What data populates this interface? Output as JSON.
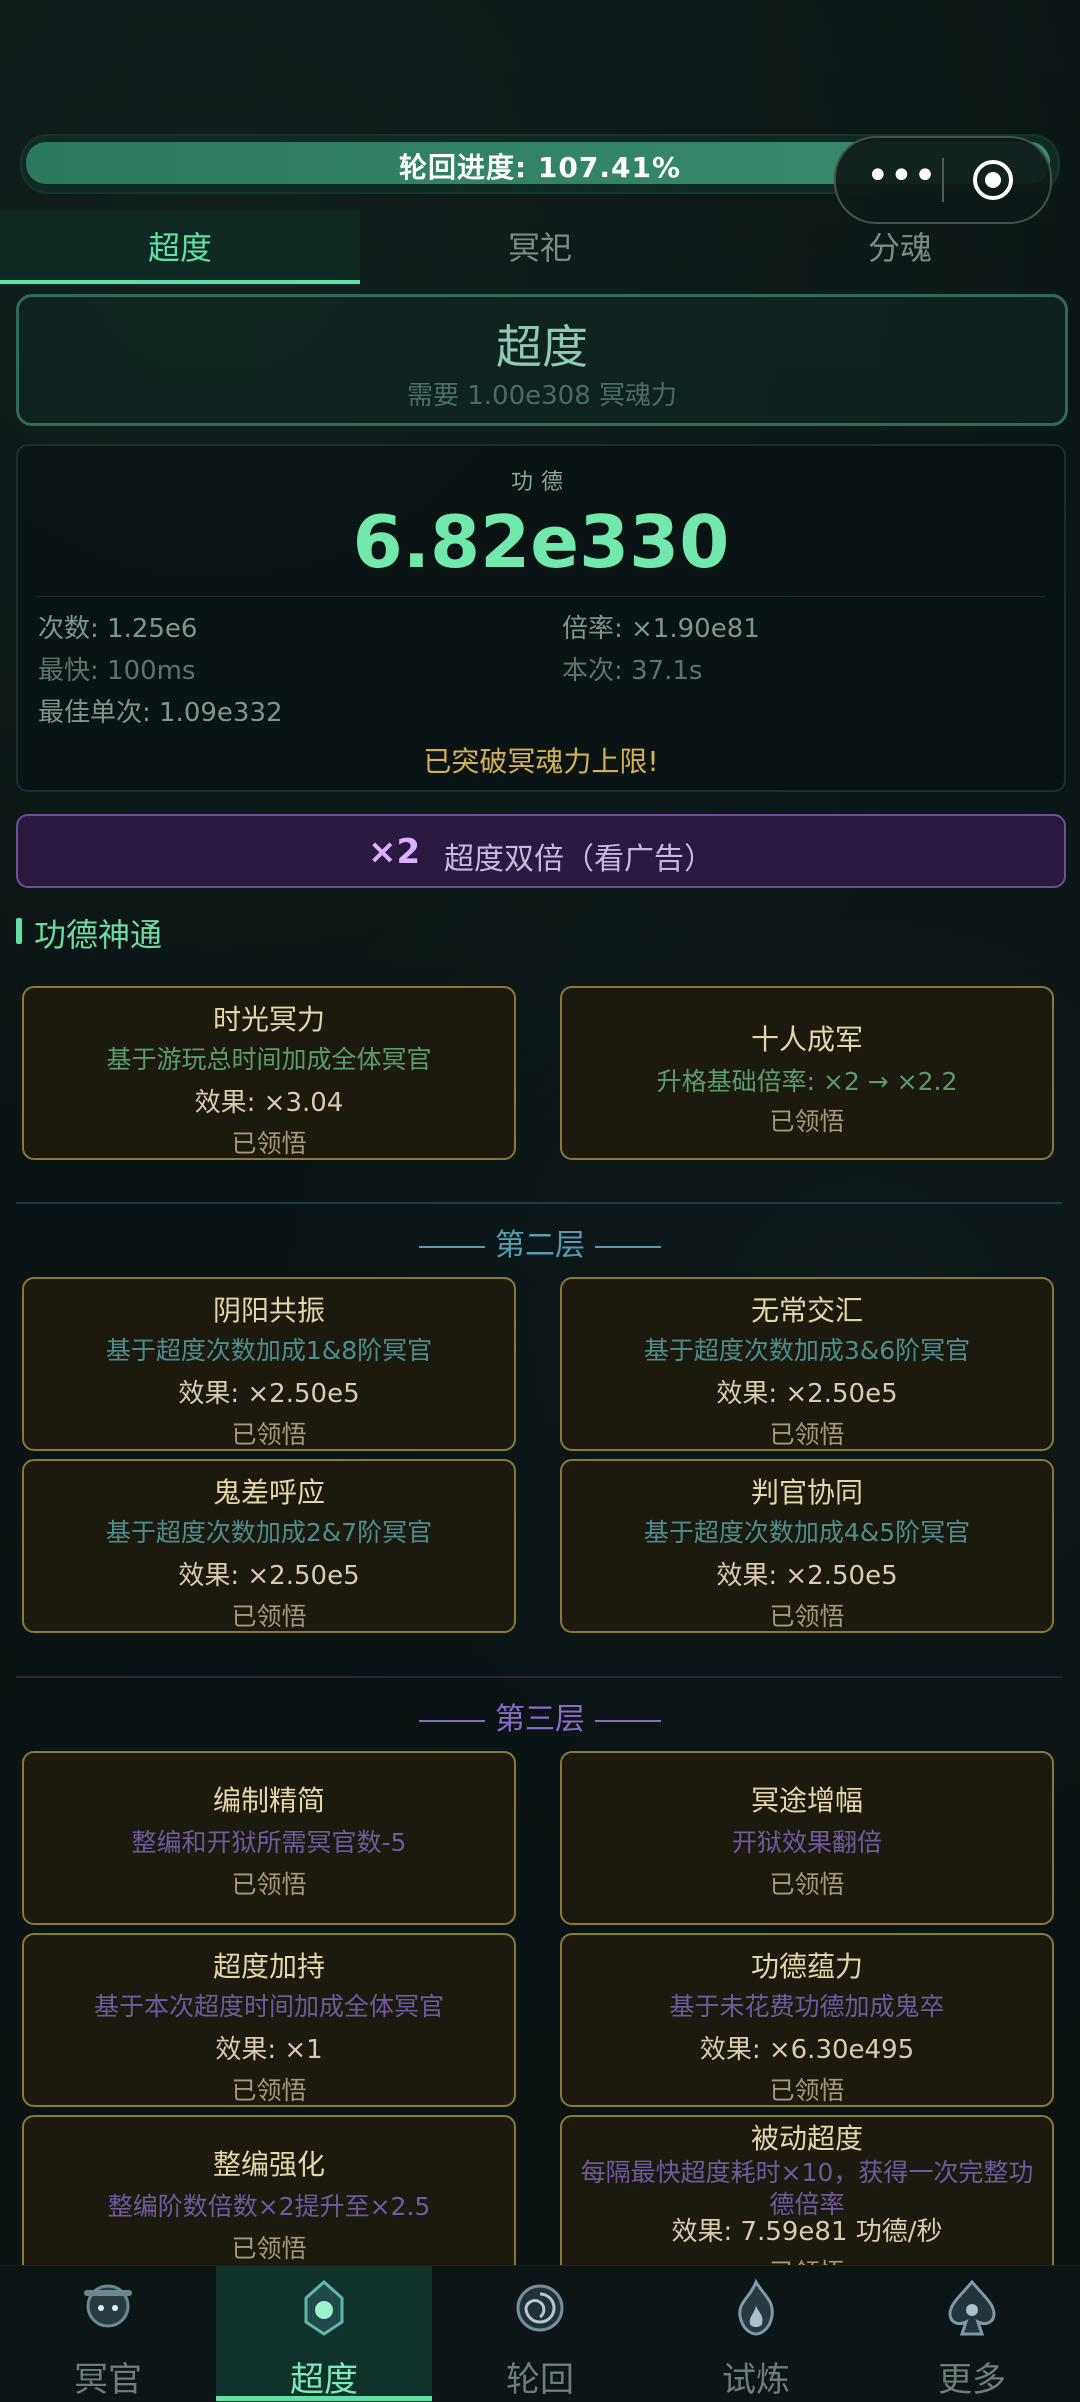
{
  "progress": {
    "label": "轮回进度: 107.41%",
    "fraction": 1.0
  },
  "capsule": {
    "more_icon": "more-dots-icon",
    "close_icon": "target-circle-icon"
  },
  "tabs": [
    {
      "label": "超度",
      "active": true
    },
    {
      "label": "冥祀",
      "active": false
    },
    {
      "label": "分魂",
      "active": false
    }
  ],
  "chaodu": {
    "title": "超度",
    "requirement": "需要 1.00e308 冥魂力"
  },
  "merit": {
    "label": "功德",
    "value": "6.82e330",
    "count": "次数: 1.25e6",
    "rate": "倍率: ×1.90e81",
    "fastest": "最快: 100ms",
    "this_time": "本次: 37.1s",
    "best_single": "最佳单次: 1.09e332",
    "breakthrough": "已突破冥魂力上限!"
  },
  "double": {
    "x2": "×2",
    "label": "超度双倍（看广告）"
  },
  "section": {
    "title": "功德神通"
  },
  "layer1": [
    {
      "name": "时光冥力",
      "desc": "基于游玩总时间加成全体冥官",
      "effect": "效果: ×3.04",
      "status": "已领悟"
    },
    {
      "name": "十人成军",
      "desc": "升格基础倍率: ×2 → ×2.2",
      "status": "已领悟"
    }
  ],
  "layer2": {
    "title": "第二层",
    "cards": [
      {
        "name": "阴阳共振",
        "desc": "基于超度次数加成1&8阶冥官",
        "effect": "效果: ×2.50e5",
        "status": "已领悟"
      },
      {
        "name": "无常交汇",
        "desc": "基于超度次数加成3&6阶冥官",
        "effect": "效果: ×2.50e5",
        "status": "已领悟"
      },
      {
        "name": "鬼差呼应",
        "desc": "基于超度次数加成2&7阶冥官",
        "effect": "效果: ×2.50e5",
        "status": "已领悟"
      },
      {
        "name": "判官协同",
        "desc": "基于超度次数加成4&5阶冥官",
        "effect": "效果: ×2.50e5",
        "status": "已领悟"
      }
    ]
  },
  "layer3": {
    "title": "第三层",
    "cards": [
      {
        "name": "编制精简",
        "desc": "整编和开狱所需冥官数-5",
        "status": "已领悟"
      },
      {
        "name": "冥途增幅",
        "desc": "开狱效果翻倍",
        "status": "已领悟"
      },
      {
        "name": "超度加持",
        "desc": "基于本次超度时间加成全体冥官",
        "effect": "效果: ×1",
        "status": "已领悟"
      },
      {
        "name": "功德蕴力",
        "desc": "基于未花费功德加成鬼卒",
        "effect": "效果: ×6.30e495",
        "status": "已领悟"
      },
      {
        "name": "整编强化",
        "desc": "整编阶数倍数×2提升至×2.5",
        "status": "已领悟"
      },
      {
        "name": "被动超度",
        "desc1": "每隔最快超度耗时×10，获得一次完整功",
        "desc2": "德倍率",
        "effect": "效果: 7.59e81 功德/秒",
        "status": "已领悟"
      }
    ]
  },
  "nav": [
    {
      "label": "冥官",
      "icon": "ghost-officer-icon"
    },
    {
      "label": "超度",
      "icon": "lantern-icon",
      "active": true
    },
    {
      "label": "轮回",
      "icon": "spiral-icon"
    },
    {
      "label": "试炼",
      "icon": "flame-icon"
    },
    {
      "label": "更多",
      "icon": "spade-icon"
    }
  ]
}
